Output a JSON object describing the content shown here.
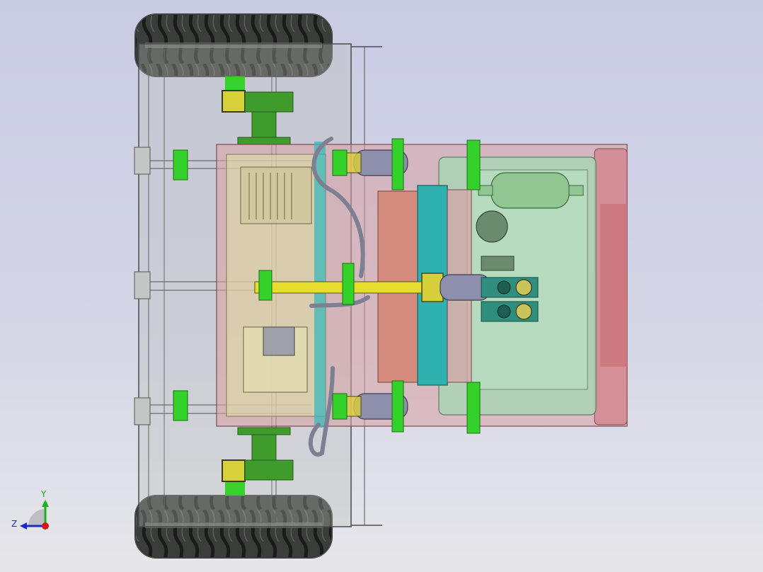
{
  "viewport": {
    "background_top": "#c9cbe3",
    "background_bottom": "#e6e6ea"
  },
  "model": {
    "parts": [
      "wheel",
      "axle-support",
      "chassis-frame",
      "hydraulic-tank",
      "hydraulic-cylinder",
      "control-valve",
      "accumulator",
      "hydraulic-hose"
    ],
    "colors": {
      "tire": "#3a3c3a",
      "green_bracket": "#3f9c2c",
      "bright_green": "#34d12a",
      "olive": "#c7c37a",
      "pink_housing": "#d9a0a3",
      "mint_panel": "#a9d3b4",
      "teal_block": "#2fb1b0",
      "salmon": "#d58b7e",
      "yellow_rod": "#e6dd2c",
      "cylinder_gray": "#8d8fad"
    }
  },
  "triad": {
    "x_label": "",
    "y_label": "Y",
    "z_label": "Z",
    "y_color": "#19b219",
    "z_color": "#1f2ad6",
    "origin_color": "#d6141b"
  }
}
